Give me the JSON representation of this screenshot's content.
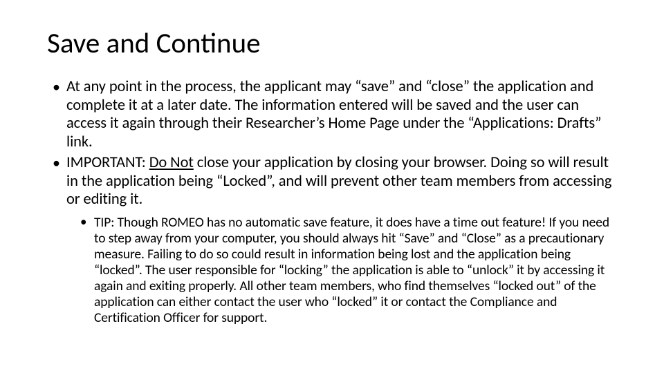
{
  "title": "Save and Continue",
  "bullets": {
    "b1": "At any point in the process, the applicant may “save” and “close” the application and complete it at a later date. The information entered will be saved and the user can access it again through their Researcher’s Home Page under the “Applications: Drafts” link.",
    "b2_prefix": "IMPORTANT: ",
    "b2_emph": "Do Not",
    "b2_rest": " close your application by closing your browser. Doing so will result in the application being “Locked”, and will prevent other team members from accessing or editing it.",
    "b3": "TIP: Though ROMEO has no automatic save feature, it does have a time out feature! If you need to step away from your computer, you should always hit “Save” and “Close” as a precautionary measure. Failing to do so could result in information being lost and the application being “locked”. The user responsible for “locking” the application is able to “unlock” it by accessing it again and exiting properly. All other team members, who find themselves “locked out” of the application can either contact the user who “locked” it or contact the Compliance and Certification Officer for support."
  }
}
